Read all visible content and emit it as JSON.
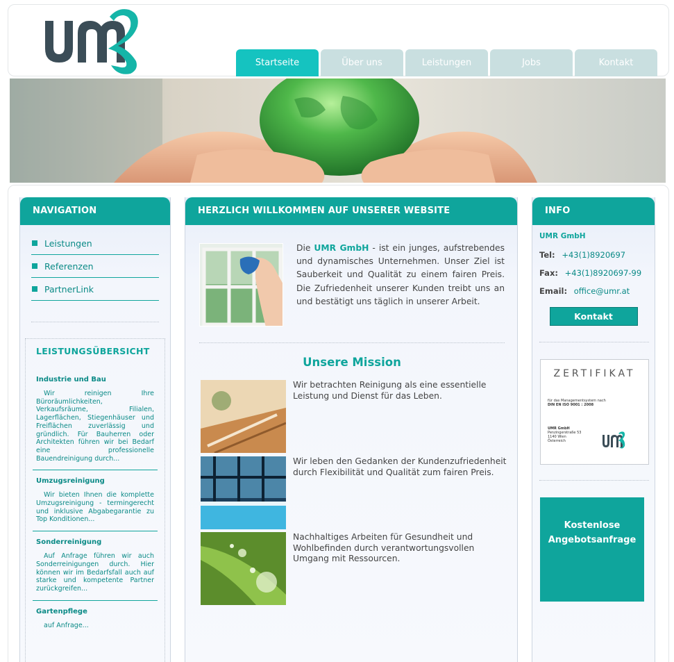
{
  "header": {
    "logo_alt": "umr",
    "tabs": [
      {
        "label": "Startseite",
        "active": true
      },
      {
        "label": "Über uns",
        "active": false
      },
      {
        "label": "Leistungen",
        "active": false
      },
      {
        "label": "Jobs",
        "active": false
      },
      {
        "label": "Kontakt",
        "active": false
      }
    ]
  },
  "colors": {
    "accent": "#0fa59c",
    "tab_active": "#15c3c0",
    "tab_inactive": "#c9dfe0"
  },
  "left": {
    "heading": "NAVIGATION",
    "nav": [
      "Leistungen",
      "Referenzen",
      "PartnerLink"
    ],
    "overview_title": "LEISTUNGSÜBERSICHT",
    "services": [
      {
        "title": "Industrie und Bau",
        "text": "Wir reinigen Ihre Büroräumlichkeiten, Verkaufsräume, Filialen, Lagerflächen, Stiegenhäuser und Freiflächen zuverlässig und gründlich. Für Bauherren oder Architekten führen wir bei Bedarf eine professionelle Bauendreinigung durch..."
      },
      {
        "title": "Umzugsreinigung",
        "text": "Wir bieten Ihnen die komplette Umzugsreinigung - termingerecht und inklusive Abgabegarantie zu Top Konditionen..."
      },
      {
        "title": "Sonderreinigung",
        "text": "Auf Anfrage führen wir auch Sonderreinigungen durch. Hier können wir im Bedarfsfall auch auf starke und kompetente Partner zurückgreifen..."
      },
      {
        "title": "Gartenpflege",
        "text": "auf Anfrage..."
      }
    ]
  },
  "main": {
    "heading": "HERZLICH WILLKOMMEN AUF UNSERER WEBSITE",
    "intro_prefix": "Die",
    "intro_brand": "UMR GmbH",
    "intro_text": "- ist ein junges, aufstrebendes und dynamisches Unternehmen. Unser Ziel ist Sauberkeit und Qualität zu einem fairen Preis. Die Zufriedenheit unserer Kunden treibt uns an und bestätigt uns täglich in unserer Arbeit.",
    "mission_title": "Unsere Mission",
    "mission": [
      "Wir betrachten Reinigung als eine essentielle Leistung und Dienst für das Leben.",
      "Wir leben den Gedanken der Kundenzufriedenheit durch Flexibilität und Qualität zum fairen Preis.",
      "Nachhaltiges Arbeiten für Gesundheit und Wohlbefinden durch verantwortungsvollen Umgang mit Ressourcen."
    ]
  },
  "right": {
    "heading": "INFO",
    "company": "UMR GmbH",
    "tel_label": "Tel:",
    "tel": "+43(1)8920697",
    "fax_label": "Fax:",
    "fax": "+43(1)8920697-99",
    "email_label": "Email:",
    "email": "office@umr.at",
    "contact_button": "Kontakt",
    "cert": {
      "title": "ZERTIFIKAT",
      "line1": "für das Managementsystem nach",
      "line2": "DIN EN ISO 9001 : 2008",
      "company": "UMR GmbH",
      "street": "Penzingerstraße 53",
      "city": "1140 Wien",
      "country": "Österreich"
    },
    "offer_line1": "Kostenlose",
    "offer_line2": "Angebotsanfrage"
  }
}
